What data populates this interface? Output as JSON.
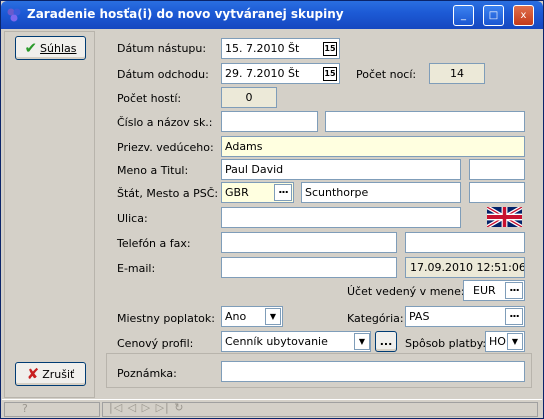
{
  "window": {
    "title": "Zaradenie hosťa(i) do novo vytváranej skupiny",
    "controls": {
      "minimize": "_",
      "maximize": "□",
      "close": "x"
    }
  },
  "buttons": {
    "confirm": "Súhlas",
    "cancel": "Zrušiť"
  },
  "form": {
    "arrival": {
      "label": "Dátum nástupu:",
      "value": "15. 7.2010  Št"
    },
    "departure": {
      "label": "Dátum odchodu:",
      "value": "29. 7.2010  Št"
    },
    "nights": {
      "label": "Počet nocí:",
      "value": "14"
    },
    "guests": {
      "label": "Počet hostí:",
      "value": "0"
    },
    "group_no": {
      "label": "Číslo a názov sk.:",
      "number": "",
      "name": ""
    },
    "leader_surname": {
      "label": "Priezv. vedúceho:",
      "value": "Adams"
    },
    "name_title": {
      "label": "Meno a Titul:",
      "name": "Paul David",
      "title": ""
    },
    "country_city": {
      "label": "Štát, Mesto a PSČ:",
      "country": "GBR",
      "city": "Scunthorpe",
      "zip": ""
    },
    "street": {
      "label": "Ulica:",
      "value": ""
    },
    "phone_fax": {
      "label": "Telefón a fax:",
      "phone": "",
      "fax": ""
    },
    "email": {
      "label": "E-mail:",
      "value": "",
      "timestamp": "17.09.2010 12:51:06"
    },
    "currency": {
      "label": "Účet vedený v mene:",
      "value": "EUR"
    },
    "local_fee": {
      "label": "Miestny poplatok:",
      "value": "Ano"
    },
    "category": {
      "label": "Kategória:",
      "value": "PAS"
    },
    "price_profile": {
      "label": "Cenový profil:",
      "value": "Cenník ubytovanie"
    },
    "payment_method": {
      "label": "Spôsob platby:",
      "value": "HO"
    },
    "note": {
      "label": "Poznámka:",
      "value": ""
    }
  },
  "icons": {
    "calendar": "15",
    "dots": "...",
    "dropdown": "▼",
    "ellipsis_button": "..."
  },
  "statusbar": {
    "help": "?",
    "nav": "|◁ ◁ ▷ ▷| ↻"
  },
  "colors": {
    "title_bar": "#1d5bd6",
    "yellow_field": "#ffffe0",
    "readonly_field": "#ece9d8"
  }
}
